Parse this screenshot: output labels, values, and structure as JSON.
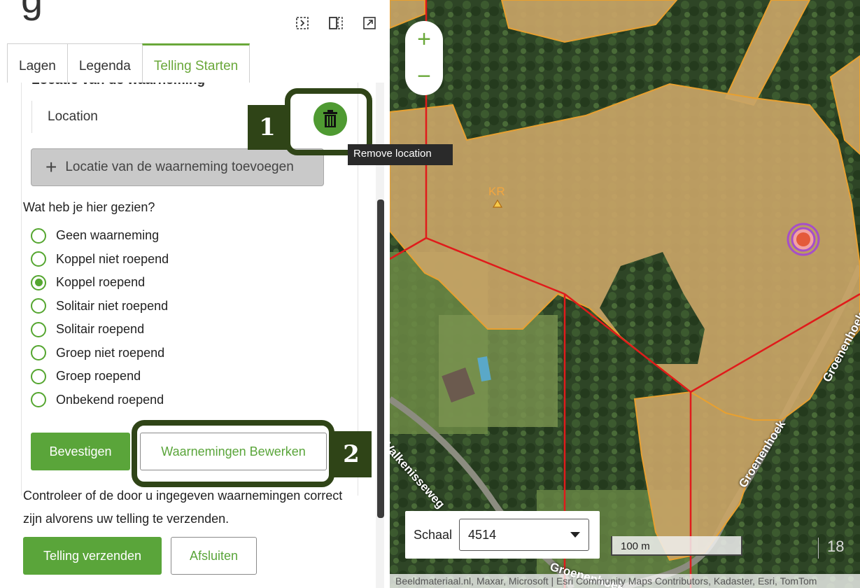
{
  "panel": {
    "top_cut_text": "g",
    "tabs": [
      {
        "label": "Lagen"
      },
      {
        "label": "Legenda"
      },
      {
        "label": "Telling Starten"
      }
    ],
    "section_cut": "Locatie van de waarneming",
    "location_label": "Location",
    "add_location_label": "Locatie van de waarneming toevoegen",
    "question": "Wat heb je hier gezien?",
    "options": [
      {
        "label": "Geen waarneming"
      },
      {
        "label": "Koppel niet roepend"
      },
      {
        "label": "Koppel roepend"
      },
      {
        "label": "Solitair niet roepend"
      },
      {
        "label": "Solitair roepend"
      },
      {
        "label": "Groep niet roepend"
      },
      {
        "label": "Groep roepend"
      },
      {
        "label": "Onbekend roepend"
      }
    ],
    "selected_option": "Koppel roepend",
    "confirm_label": "Bevestigen",
    "edit_label": "Waarnemingen Bewerken",
    "note": "Controleer of de door u ingegeven waarnemingen correct zijn alvorens uw telling te verzenden.",
    "submit_label": "Telling verzenden",
    "close_label": "Afsluiten"
  },
  "tooltip": "Remove location",
  "callouts": {
    "one": "1",
    "two": "2"
  },
  "map": {
    "zoom_in": "+",
    "zoom_out": "−",
    "kr_label": "KR",
    "scale_label": "Schaal",
    "scale_value": "4514",
    "scale_bar": "100 m",
    "page_number": "18",
    "roads": {
      "valkenisseweg": "Valkenisseweg",
      "groenenhoek": "Groenenhoek",
      "groenenhoek_right": "Groenenhoek",
      "groenenhoek_bottom": "Groenenhoek"
    },
    "attribution": "Beeldmateriaal.nl, Maxar, Microsoft | Esri Community Maps Contributors, Kadaster, Esri, TomTom"
  },
  "colors": {
    "accent": "#5aa53a",
    "callout": "#2f4417",
    "field": "#c8a466",
    "boundary": "#e01b1b"
  }
}
